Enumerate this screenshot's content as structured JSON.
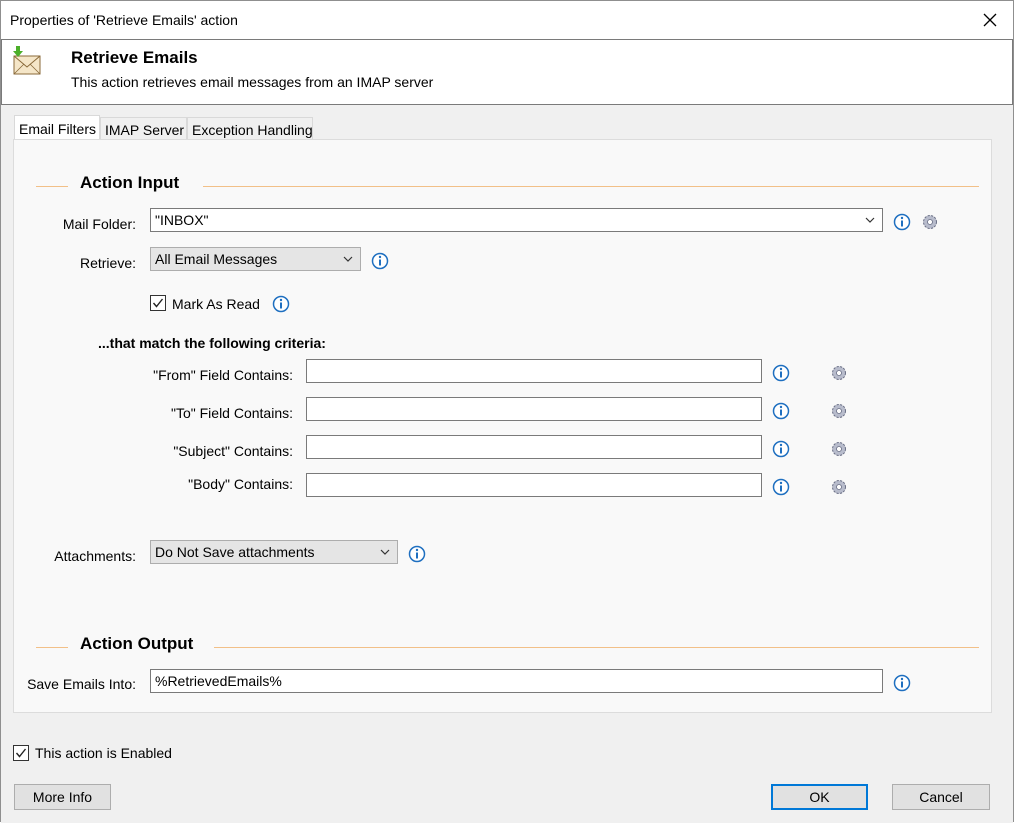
{
  "window": {
    "title": "Properties of 'Retrieve Emails' action"
  },
  "header": {
    "title": "Retrieve Emails",
    "description": "This action retrieves email messages from an IMAP server"
  },
  "tabs": [
    {
      "label": "Email Filters"
    },
    {
      "label": "IMAP Server"
    },
    {
      "label": "Exception Handling"
    }
  ],
  "input_section": {
    "title": "Action Input",
    "mail_folder_label": "Mail Folder:",
    "mail_folder_value": "\"INBOX\"",
    "retrieve_label": "Retrieve:",
    "retrieve_value": "All Email Messages",
    "mark_as_read_label": "Mark As Read",
    "mark_as_read_checked": true,
    "criteria_heading": "...that match the following criteria:",
    "from_label": "\"From\" Field Contains:",
    "from_value": "",
    "to_label": "\"To\" Field Contains:",
    "to_value": "",
    "subject_label": "\"Subject\" Contains:",
    "subject_value": "",
    "body_label": "\"Body\" Contains:",
    "body_value": "",
    "attachments_label": "Attachments:",
    "attachments_value": "Do Not Save attachments"
  },
  "output_section": {
    "title": "Action Output",
    "save_label": "Save Emails Into:",
    "save_value": "%RetrievedEmails%"
  },
  "footer": {
    "enabled_label": "This action is Enabled",
    "enabled_checked": true,
    "more_info": "More Info",
    "ok": "OK",
    "cancel": "Cancel"
  },
  "colors": {
    "section_line": "#f2c088",
    "info_icon": "#1e6fc0",
    "default_button_border": "#0078d7"
  }
}
